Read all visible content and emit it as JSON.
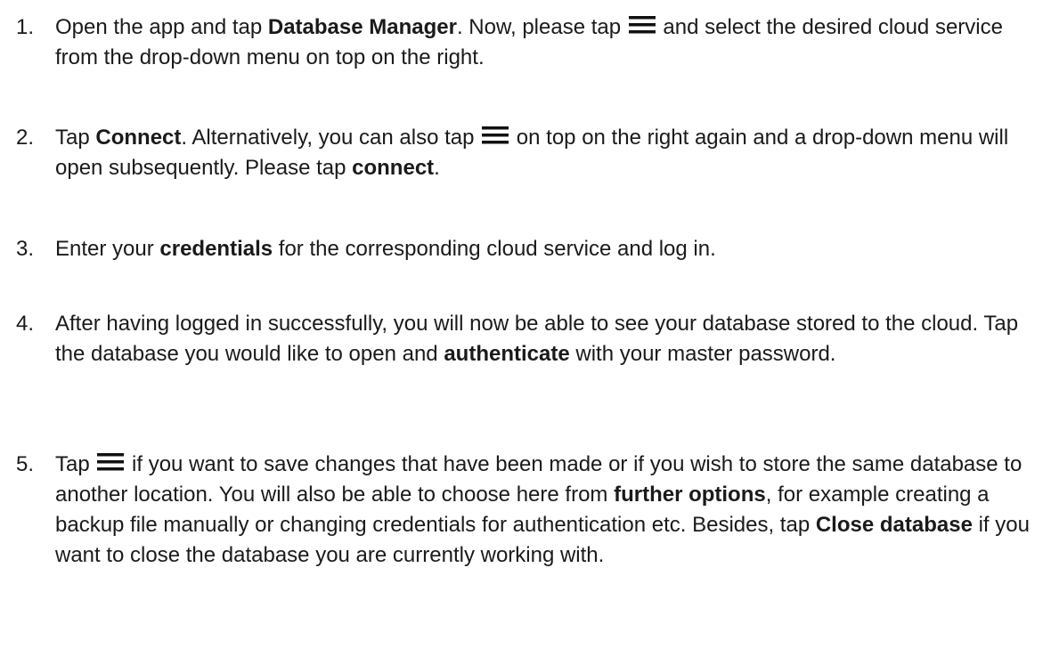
{
  "steps": [
    {
      "number": "1.",
      "parts": [
        "Open the app and tap ",
        "Database Manager",
        ". Now, please tap ",
        " and select the desired cloud service from the drop-down menu on top on the right."
      ]
    },
    {
      "number": "2.",
      "parts": [
        "Tap ",
        "Connect",
        ". Alternatively, you can also tap ",
        " on top on the right again and a drop-down menu will open subsequently. Please tap ",
        "connect",
        "."
      ]
    },
    {
      "number": "3.",
      "parts": [
        "Enter your ",
        "credentials",
        " for the corresponding cloud service and log in."
      ]
    },
    {
      "number": "4.",
      "parts": [
        "After having logged in successfully, you will now be able to see your database stored to the cloud. Tap the database you would like to open and ",
        "authenticate",
        " with your master password."
      ]
    },
    {
      "number": "5.",
      "parts": [
        "Tap ",
        " if you want to save changes that have been made or if you wish to store the same database to another location. You will also be able to choose here from ",
        "further options",
        ", for example creating a backup file manually or changing credentials for authentication etc. Besides, tap ",
        "Close database",
        " if you want to close the database you are currently working with."
      ]
    }
  ],
  "icons": {
    "menu": "hamburger-menu-icon"
  }
}
